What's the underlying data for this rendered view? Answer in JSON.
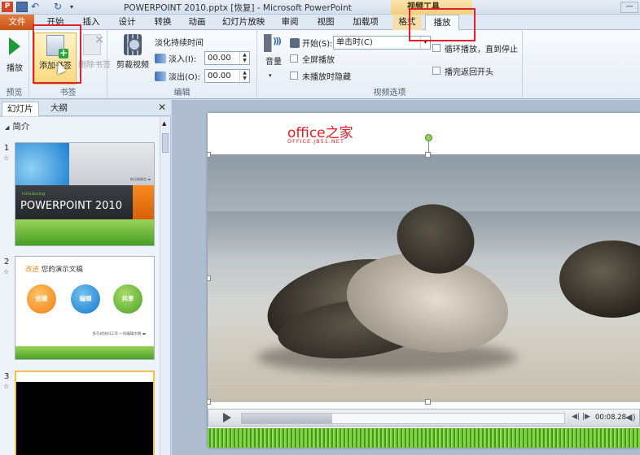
{
  "titlebar": {
    "app_icon_letter": "P",
    "window_title": "POWERPOINT 2010.pptx [恢复] - Microsoft PowerPoint",
    "context_group": "视频工具",
    "minimize_symbol": "—"
  },
  "tabs": {
    "file": "文件",
    "items": [
      "开始",
      "插入",
      "设计",
      "转换",
      "动画",
      "幻灯片放映",
      "审阅",
      "视图",
      "加载项"
    ],
    "video_format": "格式",
    "video_playback": "播放"
  },
  "ribbon": {
    "preview": {
      "group_label": "预览",
      "play_label": "播放"
    },
    "bookmarks": {
      "group_label": "书签",
      "add_label": "添加书签",
      "remove_label": "删除书签"
    },
    "edit": {
      "group_label": "编辑",
      "trim_label": "剪裁视频",
      "fade_duration_label": "淡化持续时间",
      "fade_in_label": "淡入(I):",
      "fade_in_value": "00.00",
      "fade_out_label": "淡出(O):",
      "fade_out_value": "00.00"
    },
    "video_options": {
      "group_label": "视频选项",
      "volume_label": "音量",
      "start_label": "开始(S):",
      "start_value": "单击时(C)",
      "fullscreen_label": "全屏播放",
      "hide_not_playing_label": "未播放时隐藏",
      "loop_label": "循环播放，直到停止",
      "rewind_label": "播完返回开头"
    }
  },
  "panel": {
    "tab_slides": "幻灯片",
    "tab_outline": "大纲",
    "close_symbol": "✕",
    "section_name": "简介",
    "slides": [
      {
        "number": "1",
        "star": "☆"
      },
      {
        "number": "2",
        "star": "☆"
      },
      {
        "number": "3",
        "star": "☆"
      }
    ],
    "thumb1": {
      "intro": "Introducing",
      "title": "POWERPOINT 2010",
      "sub": "新功能概览 ▬"
    },
    "thumb2": {
      "title_accent": "改进",
      "title_rest": " 您的演示文稿",
      "circle1": "创建",
      "circle2": "编辑",
      "circle3": "共享",
      "footer": "多方式协同工作 一同编辑文稿 ▬"
    }
  },
  "slide": {
    "logo_text": "office之家",
    "logo_sub": "OFFICE.JB51.NET",
    "player_time": "00:08.28"
  },
  "colors": {
    "highlight": "#e0232a",
    "file_tab": "#c8531a",
    "video_tools": "#f3cf7d",
    "logo": "#e31c23"
  }
}
